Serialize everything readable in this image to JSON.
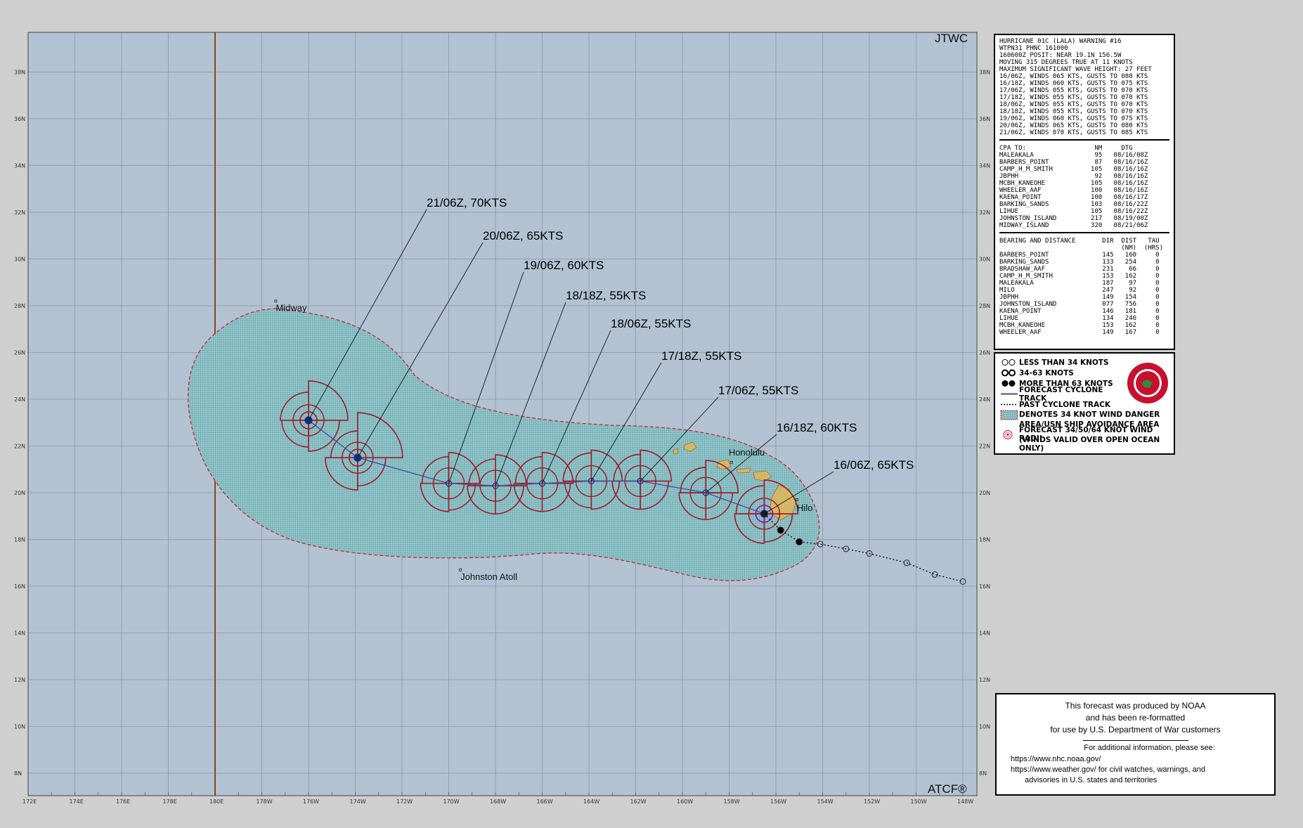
{
  "map": {
    "agency_label": "JTWC",
    "atcf_label": "ATCF®",
    "lat_labels": [
      "38N",
      "36N",
      "34N",
      "32N",
      "30N",
      "28N",
      "26N",
      "24N",
      "22N",
      "20N",
      "18N",
      "16N",
      "14N",
      "12N",
      "10N",
      "8N"
    ],
    "lon_labels": [
      "172E",
      "174E",
      "176E",
      "178E",
      "180E",
      "178W",
      "176W",
      "174W",
      "172W",
      "170W",
      "168W",
      "166W",
      "164W",
      "162W",
      "160W",
      "158W",
      "156W",
      "154W",
      "152W",
      "150W",
      "148W"
    ],
    "places": [
      {
        "name": "Midway",
        "lat": 28.2,
        "lon": -177.4
      },
      {
        "name": "Johnston Atoll",
        "lat": 16.7,
        "lon": -169.5
      },
      {
        "name": "Honolulu",
        "lat": 21.3,
        "lon": -157.9
      },
      {
        "name": "Hilo",
        "lat": 19.7,
        "lon": -155.1
      }
    ],
    "forecast_track": [
      {
        "label": "16/06Z,  65KTS",
        "lat": 19.1,
        "lon": -156.5,
        "intensity_kts": 65
      },
      {
        "label": "16/18Z,  60KTS",
        "lat": 20.0,
        "lon": -159.0,
        "intensity_kts": 60
      },
      {
        "label": "17/06Z,  55KTS",
        "lat": 20.5,
        "lon": -161.8,
        "intensity_kts": 55
      },
      {
        "label": "17/18Z,  55KTS",
        "lat": 20.5,
        "lon": -163.9,
        "intensity_kts": 55
      },
      {
        "label": "18/06Z,  55KTS",
        "lat": 20.4,
        "lon": -166.0,
        "intensity_kts": 55
      },
      {
        "label": "18/18Z,  55KTS",
        "lat": 20.3,
        "lon": -168.0,
        "intensity_kts": 55
      },
      {
        "label": "19/06Z,  60KTS",
        "lat": 20.4,
        "lon": -170.0,
        "intensity_kts": 60
      },
      {
        "label": "20/06Z,  65KTS",
        "lat": 21.5,
        "lon": -173.9,
        "intensity_kts": 65
      },
      {
        "label": "21/06Z,  70KTS",
        "lat": 23.1,
        "lon": -176.0,
        "intensity_kts": 70
      }
    ],
    "past_track": [
      {
        "lat": 18.4,
        "lon": -155.8
      },
      {
        "lat": 17.9,
        "lon": -155.0
      },
      {
        "lat": 17.8,
        "lon": -154.1
      },
      {
        "lat": 17.6,
        "lon": -153.0
      },
      {
        "lat": 17.4,
        "lon": -152.0
      },
      {
        "lat": 17.0,
        "lon": -150.4
      },
      {
        "lat": 16.5,
        "lon": -149.2
      },
      {
        "lat": 16.2,
        "lon": -148.0
      }
    ],
    "colors": {
      "ocean": "#b2c2d2",
      "grid": "#8796a8",
      "danger_area": "#8cc3c8",
      "danger_border": "#c81e1e",
      "wind_radii": "#9e1a24",
      "track": "#3a4fa0",
      "land": "#d4b766",
      "dateline": "#8b4513"
    }
  },
  "warning": {
    "header": [
      "HURRICANE 01C (LALA) WARNING #16",
      "WTPN31 PHNC 161000",
      "160600Z POSIT: NEAR 19.1N 156.5W",
      "MOVING 315 DEGREES TRUE AT 11 KNOTS",
      "MAXIMUM SIGNIFICANT WAVE HEIGHT: 27 FEET",
      "16/06Z, WINDS 065 KTS, GUSTS TO 080 KTS",
      "16/18Z, WINDS 060 KTS, GUSTS TO 075 KTS",
      "17/06Z, WINDS 055 KTS, GUSTS TO 070 KTS",
      "17/18Z, WINDS 055 KTS, GUSTS TO 070 KTS",
      "18/06Z, WINDS 055 KTS, GUSTS TO 070 KTS",
      "18/18Z, WINDS 055 KTS, GUSTS TO 070 KTS",
      "19/06Z, WINDS 060 KTS, GUSTS TO 075 KTS",
      "20/06Z, WINDS 065 KTS, GUSTS TO 080 KTS",
      "21/06Z, WINDS 070 KTS, GUSTS TO 085 KTS"
    ],
    "cpa_header": "CPA TO:                  NM     DTG",
    "cpa_rows": [
      "MALEAKALA                95   08/16/08Z",
      "BARBERS_POINT            87   08/16/16Z",
      "CAMP_H_M_SMITH          105   08/16/16Z",
      "JBPHH                    92   08/16/16Z",
      "MCBH_KANEOHE            105   08/16/16Z",
      "WHEELER_AAF             100   08/16/16Z",
      "KAENA_POINT             100   08/16/17Z",
      "BARKING_SANDS           103   08/16/22Z",
      "LIHUE                   105   08/16/22Z",
      "JOHNSTON_ISLAND         217   08/19/00Z",
      "MIDWAY_ISLAND           320   08/21/06Z"
    ],
    "bearing_header_1": "BEARING AND DISTANCE       DIR  DIST   TAU",
    "bearing_header_2": "                                (NM)  (HRS)",
    "bearing_rows": [
      "BARBERS_POINT              145   160     0",
      "BARKING_SANDS              133   254     0",
      "BRADSHAW_AAF               231    66     0",
      "CAMP_H_M_SMITH             153   162     0",
      "MALEAKALA                  187    97     0",
      "MILO                       247    92     0",
      "JBPHH                      149   154     0",
      "JOHNSTON_ISLAND            077   756     0",
      "KAENA_POINT                146   181     0",
      "LIHUE                      134   246     0",
      "MCBH_KANEOHE               153   162     0",
      "WHEELER_AAF                149   167     0"
    ]
  },
  "legend": {
    "items": [
      "LESS THAN 34 KNOTS",
      "34-63 KNOTS",
      "MORE THAN 63 KNOTS",
      "FORECAST CYCLONE TRACK",
      "PAST CYCLONE TRACK",
      "DENOTES 34 KNOT WIND DANGER",
      "AREA/USN SHIP AVOIDANCE AREA",
      "FORECAST 34/50/64 KNOT WIND RADII",
      "(WINDS VALID OVER OPEN OCEAN ONLY)"
    ]
  },
  "notice": {
    "line1": "This forecast was produced by NOAA",
    "line2": "and has been re-formatted",
    "line3": "for use by U.S. Department of War customers",
    "line4": "For additional information, please see:",
    "line5": "https://www.nhc.noaa.gov/",
    "line6": "https://www.weather.gov/ for civil watches, warnings, and",
    "line7": "advisories in U.S. states and territories"
  }
}
